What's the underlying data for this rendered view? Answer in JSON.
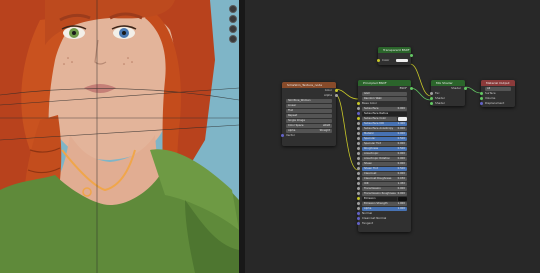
{
  "colors": {
    "viewport_bg": "#7fb5c7",
    "editor_bg": "#282828",
    "node_bg": "#303030",
    "texture_header": "#884b2a",
    "shader_header": "#2b652b",
    "output_header": "#8b3a3a",
    "input_header": "#474747",
    "field_bg": "#545454",
    "field_active": "#4772b3",
    "wire": "#c7c729",
    "socket_yellow": "#c7c729",
    "socket_gray": "#a1a1a1",
    "socket_purple": "#6363c7",
    "socket_green": "#63c763"
  },
  "icons": {
    "gizmo_1": "view-axis-icon",
    "gizmo_2": "zoom-icon",
    "gizmo_3": "camera-icon",
    "gizmo_4": "grid-icon"
  },
  "nodes": {
    "value": {
      "title": "Transparent BSDF",
      "field_label": "Color"
    },
    "texture": {
      "title": "SimsSkin_Texture_node",
      "out_color": "Color",
      "out_alpha": "Alpha",
      "image": "SkinTone_Woman",
      "rows": [
        "Linear",
        "Flat",
        "Repeat",
        "Single Image",
        "Color Space",
        "Alpha",
        "Vector"
      ],
      "color_space_value": "sRGB",
      "alpha_value": "Straight"
    },
    "principled": {
      "title": "Principled BSDF",
      "out_bsdf": "BSDF",
      "rows": [
        "GGX",
        "Random Walk",
        "Base Color",
        "Subsurface",
        "Subsurface Radius",
        "Subsurface Color",
        "Subsurface IOR",
        "Subsurface Anisotropy",
        "Metallic",
        "Specular",
        "Specular Tint",
        "Roughness",
        "Anisotropic",
        "Anisotropic Rotation",
        "Sheen",
        "Sheen Tint",
        "Clearcoat",
        "Clearcoat Roughness",
        "IOR",
        "Transmission",
        "Transmission Roughness",
        "Emission",
        "Emission Strength",
        "Alpha",
        "Normal",
        "Clearcoat Normal",
        "Tangent"
      ],
      "values": [
        "",
        "",
        "",
        "0.000",
        "",
        "",
        "1.400",
        "0.000",
        "0.000",
        "0.500",
        "0.000",
        "0.500",
        "0.000",
        "0.000",
        "0.000",
        "0.500",
        "0.000",
        "0.030",
        "1.450",
        "0.000",
        "0.000",
        "",
        "1.000",
        "1.000",
        "",
        "",
        ""
      ]
    },
    "mix": {
      "title": "Mix Shader",
      "out_shader": "Shader",
      "rows": [
        "Fac",
        "Shader",
        "Shader"
      ]
    },
    "output": {
      "title": "Material Output",
      "target": "All",
      "rows": [
        "Surface",
        "Volume",
        "Displacement"
      ]
    }
  }
}
